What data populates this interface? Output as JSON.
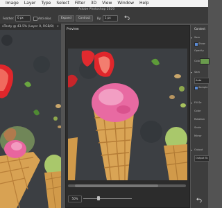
{
  "menubar": {
    "items": [
      "Image",
      "Layer",
      "Type",
      "Select",
      "Filter",
      "3D",
      "View",
      "Window",
      "Help"
    ]
  },
  "options": {
    "feather_label": "Feather:",
    "feather_value": "0 px",
    "antialias_label": "Anti-alias",
    "expand_label": "Expand",
    "contract_label": "Contract",
    "by_label": "By:",
    "by_value": "1 px",
    "app_title": "Adobe Photoshop 2020"
  },
  "document_tab": {
    "label": "xTexty @ 43.5% (Layer 0, RGB/8)",
    "close": "×"
  },
  "preview": {
    "title": "Preview",
    "zoom": "50%"
  },
  "dock": {
    "title": "Content",
    "rows": [
      "Sam",
      "Show",
      "Opacity",
      "Color",
      "Sam",
      "Auto",
      "Sample",
      "Fill Se",
      "Color",
      "Rotation",
      "Scale",
      "Mirror",
      "Output",
      "Output"
    ],
    "auto_value": "Auto",
    "output_value": "Output To"
  },
  "colors": {
    "menubar": "#f2f2f2",
    "app_bg": "#535353",
    "panel": "#3d3d3d",
    "accent": "#5a8bd6",
    "overlay_green": "#6a9b4d"
  },
  "icons": {
    "undo": "undo-icon",
    "close": "close-icon"
  }
}
